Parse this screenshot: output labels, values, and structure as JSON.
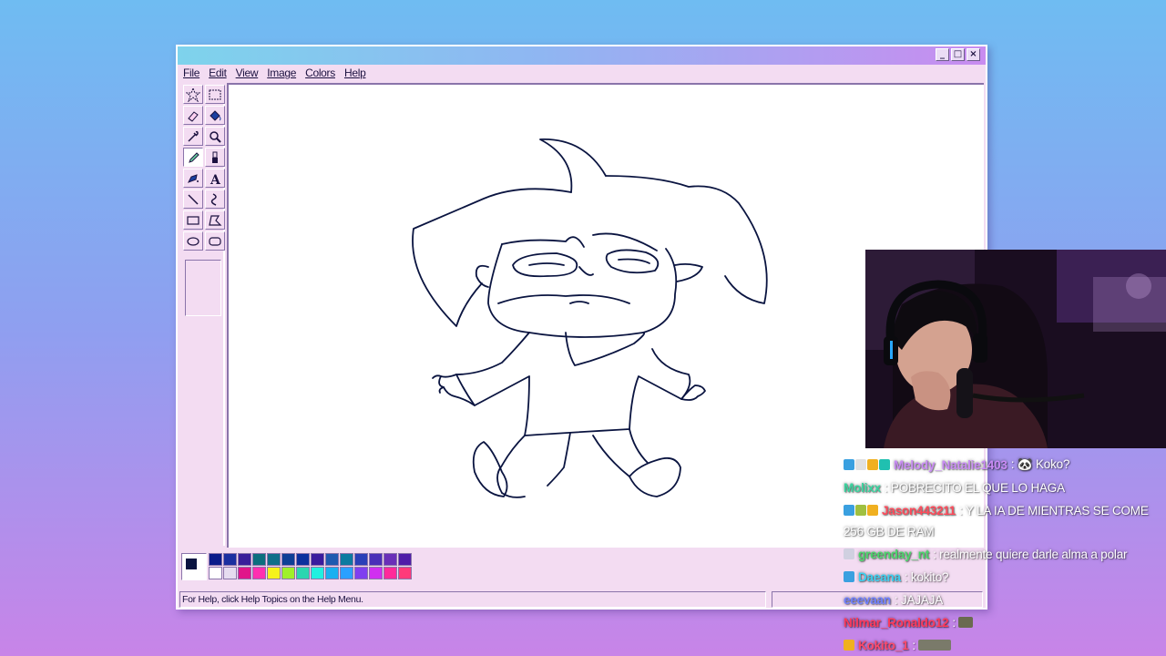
{
  "window": {
    "controls": [
      "_",
      "□",
      "×"
    ]
  },
  "menu": [
    "File",
    "Edit",
    "View",
    "Image",
    "Colors",
    "Help"
  ],
  "tools": [
    "free-select-tool",
    "select-tool",
    "eraser-tool",
    "fill-tool",
    "color-picker-tool",
    "magnifier-tool",
    "pencil-tool",
    "brush-tool",
    "airbrush-tool",
    "text-tool",
    "line-tool",
    "curve-tool",
    "rectangle-tool",
    "polygon-tool",
    "ellipse-tool",
    "rounded-rectangle-tool"
  ],
  "active_tool": "pencil-tool",
  "palette": {
    "foreground": "#0a1440",
    "background": "#ffffff",
    "row1": [
      "#0a1c8a",
      "#1b2fa0",
      "#3a1e9a",
      "#0c6e7e",
      "#106e8a",
      "#0e3f96",
      "#0b2f9e",
      "#3a1b9e",
      "#1f5ab0",
      "#0c7aa0",
      "#2a3fb8",
      "#4a2fb8",
      "#6a2fb8",
      "#4f1ca8"
    ],
    "row2": [
      "#ffffff",
      "#e6dcf0",
      "#e0168a",
      "#ff2fb0",
      "#f5f21b",
      "#9ff02a",
      "#2ad6b0",
      "#20f0e0",
      "#1ab0f0",
      "#2aa0ff",
      "#7f3ff0",
      "#d02ff0",
      "#ff2a9a",
      "#ff3a7a"
    ]
  },
  "statusbar": {
    "help_text": "For Help, click Help Topics on the Help Menu."
  },
  "chat": [
    {
      "user": "Melody_Natalie1403",
      "color": "#c98bf5",
      "message": ": 🐼 Koko?",
      "badges": [
        "#3aa0e0",
        "#e0e0e0",
        "#f0b020",
        "#20c0b0"
      ]
    },
    {
      "user": "Molixx",
      "color": "#3ad6a0",
      "message": ": POBRECITO EL QUE LO HAGA",
      "badges": []
    },
    {
      "user": "Jason443211",
      "color": "#ff4a5a",
      "message": ": Y LA IA DE MIENTRAS SE COME",
      "badges": [
        "#3aa0e0",
        "#a0c040",
        "#f0b020"
      ]
    },
    {
      "user": "",
      "color": "#ffffff",
      "message": "256 GB DE RAM",
      "badges": []
    },
    {
      "user": "greenday_nt",
      "color": "#4ad66a",
      "message": ": realmente quiere darle alma a polar",
      "badges": [
        "#d0d0e0"
      ]
    },
    {
      "user": "Daeana",
      "color": "#3ad0f0",
      "message": ": kokito?",
      "badges": [
        "#3aa0e0"
      ]
    },
    {
      "user": "eeevaan",
      "color": "#7080ff",
      "message": ": JAJAJA",
      "badges": []
    },
    {
      "user": "Nilmar_Ronaldo12",
      "color": "#ff3a5a",
      "message": ":",
      "badges": []
    },
    {
      "user": "Kokito_1",
      "color": "#ff4a6a",
      "message": ":",
      "badges": [
        "#f0b020"
      ]
    }
  ]
}
